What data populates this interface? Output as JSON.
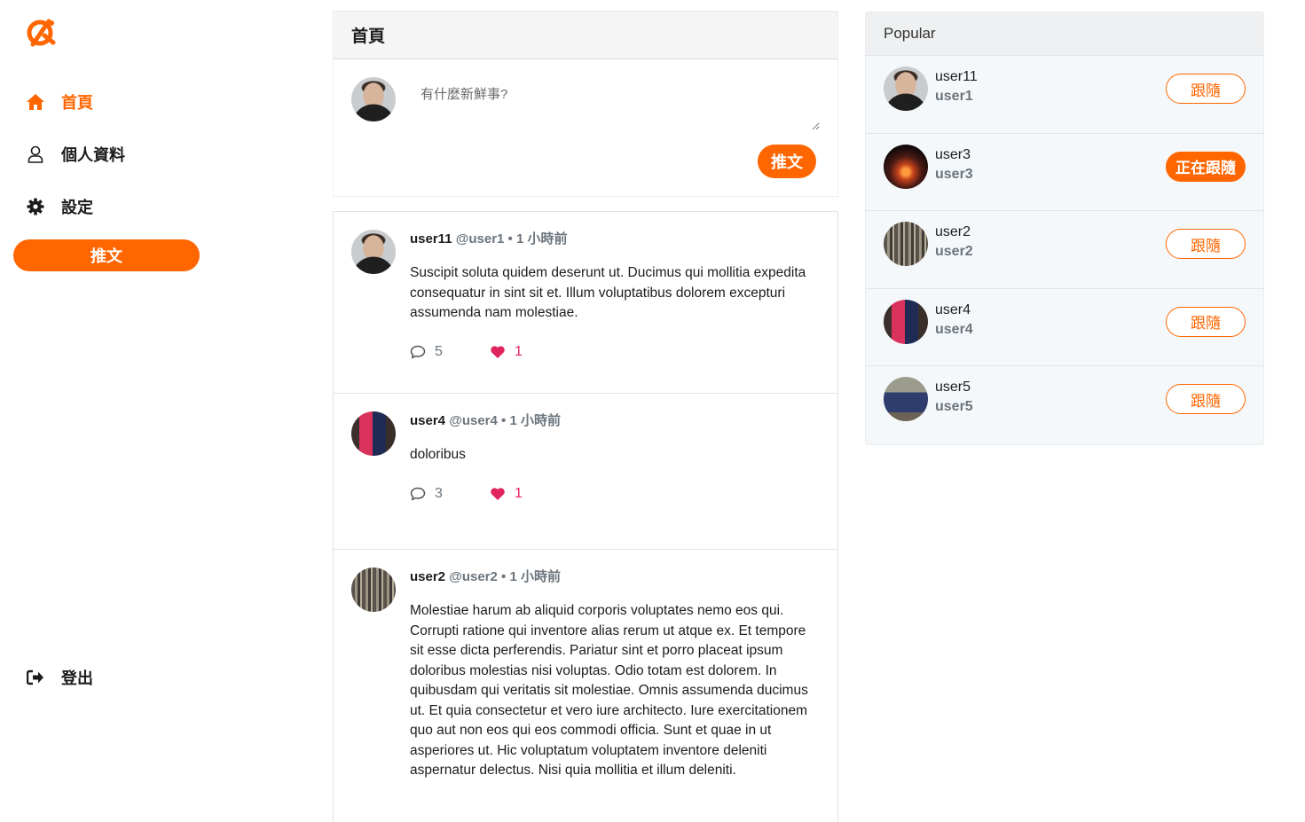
{
  "sidebar": {
    "logo": "alphacamp-logo",
    "nav": [
      {
        "label": "首頁",
        "icon": "home-icon",
        "active": true
      },
      {
        "label": "個人資料",
        "icon": "user-icon",
        "active": false
      },
      {
        "label": "設定",
        "icon": "gear-icon",
        "active": false
      }
    ],
    "tweet_button": "推文",
    "logout_label": "登出"
  },
  "main": {
    "title": "首頁",
    "composer": {
      "placeholder": "有什麼新鮮事?",
      "submit_label": "推文"
    },
    "tweets": [
      {
        "name": "user11",
        "handle": "@user1",
        "meta": "• 1 小時前",
        "body": "Suscipit soluta quidem deserunt ut. Ducimus qui mollitia expedita consequatur in sint sit et. Illum voluptatibus dolorem excepturi assumenda nam molestiae.",
        "replies": "5",
        "likes": "1"
      },
      {
        "name": "user4",
        "handle": "@user4",
        "meta": "• 1 小時前",
        "body": "doloribus",
        "replies": "3",
        "likes": "1"
      },
      {
        "name": "user2",
        "handle": "@user2",
        "meta": "• 1 小時前",
        "body": "Molestiae harum ab aliquid corporis voluptates nemo eos qui. Corrupti ratione qui inventore alias rerum ut atque ex. Et tempore sit esse dicta perferendis. Pariatur sint et porro placeat ipsum doloribus molestias nisi voluptas. Odio totam est dolorem. In quibusdam qui veritatis sit molestiae. Omnis assumenda ducimus ut. Et quia consectetur et vero iure architecto. Iure exercitationem quo aut non eos qui eos commodi officia. Sunt et quae in ut asperiores ut. Hic voluptatum voluptatem inventore deleniti aspernatur delectus. Nisi quia mollitia et illum deleniti."
      }
    ]
  },
  "popular": {
    "title": "Popular",
    "users": [
      {
        "name": "user11",
        "handle": "user1",
        "button": "跟隨",
        "following": false
      },
      {
        "name": "user3",
        "handle": "user3",
        "button": "正在跟隨",
        "following": true
      },
      {
        "name": "user2",
        "handle": "user2",
        "button": "跟隨",
        "following": false
      },
      {
        "name": "user4",
        "handle": "user4",
        "button": "跟隨",
        "following": false
      },
      {
        "name": "user5",
        "handle": "user5",
        "button": "跟隨",
        "following": false
      }
    ]
  },
  "colors": {
    "accent": "#ff6600",
    "like": "#e0245e",
    "muted": "#6c757d"
  }
}
